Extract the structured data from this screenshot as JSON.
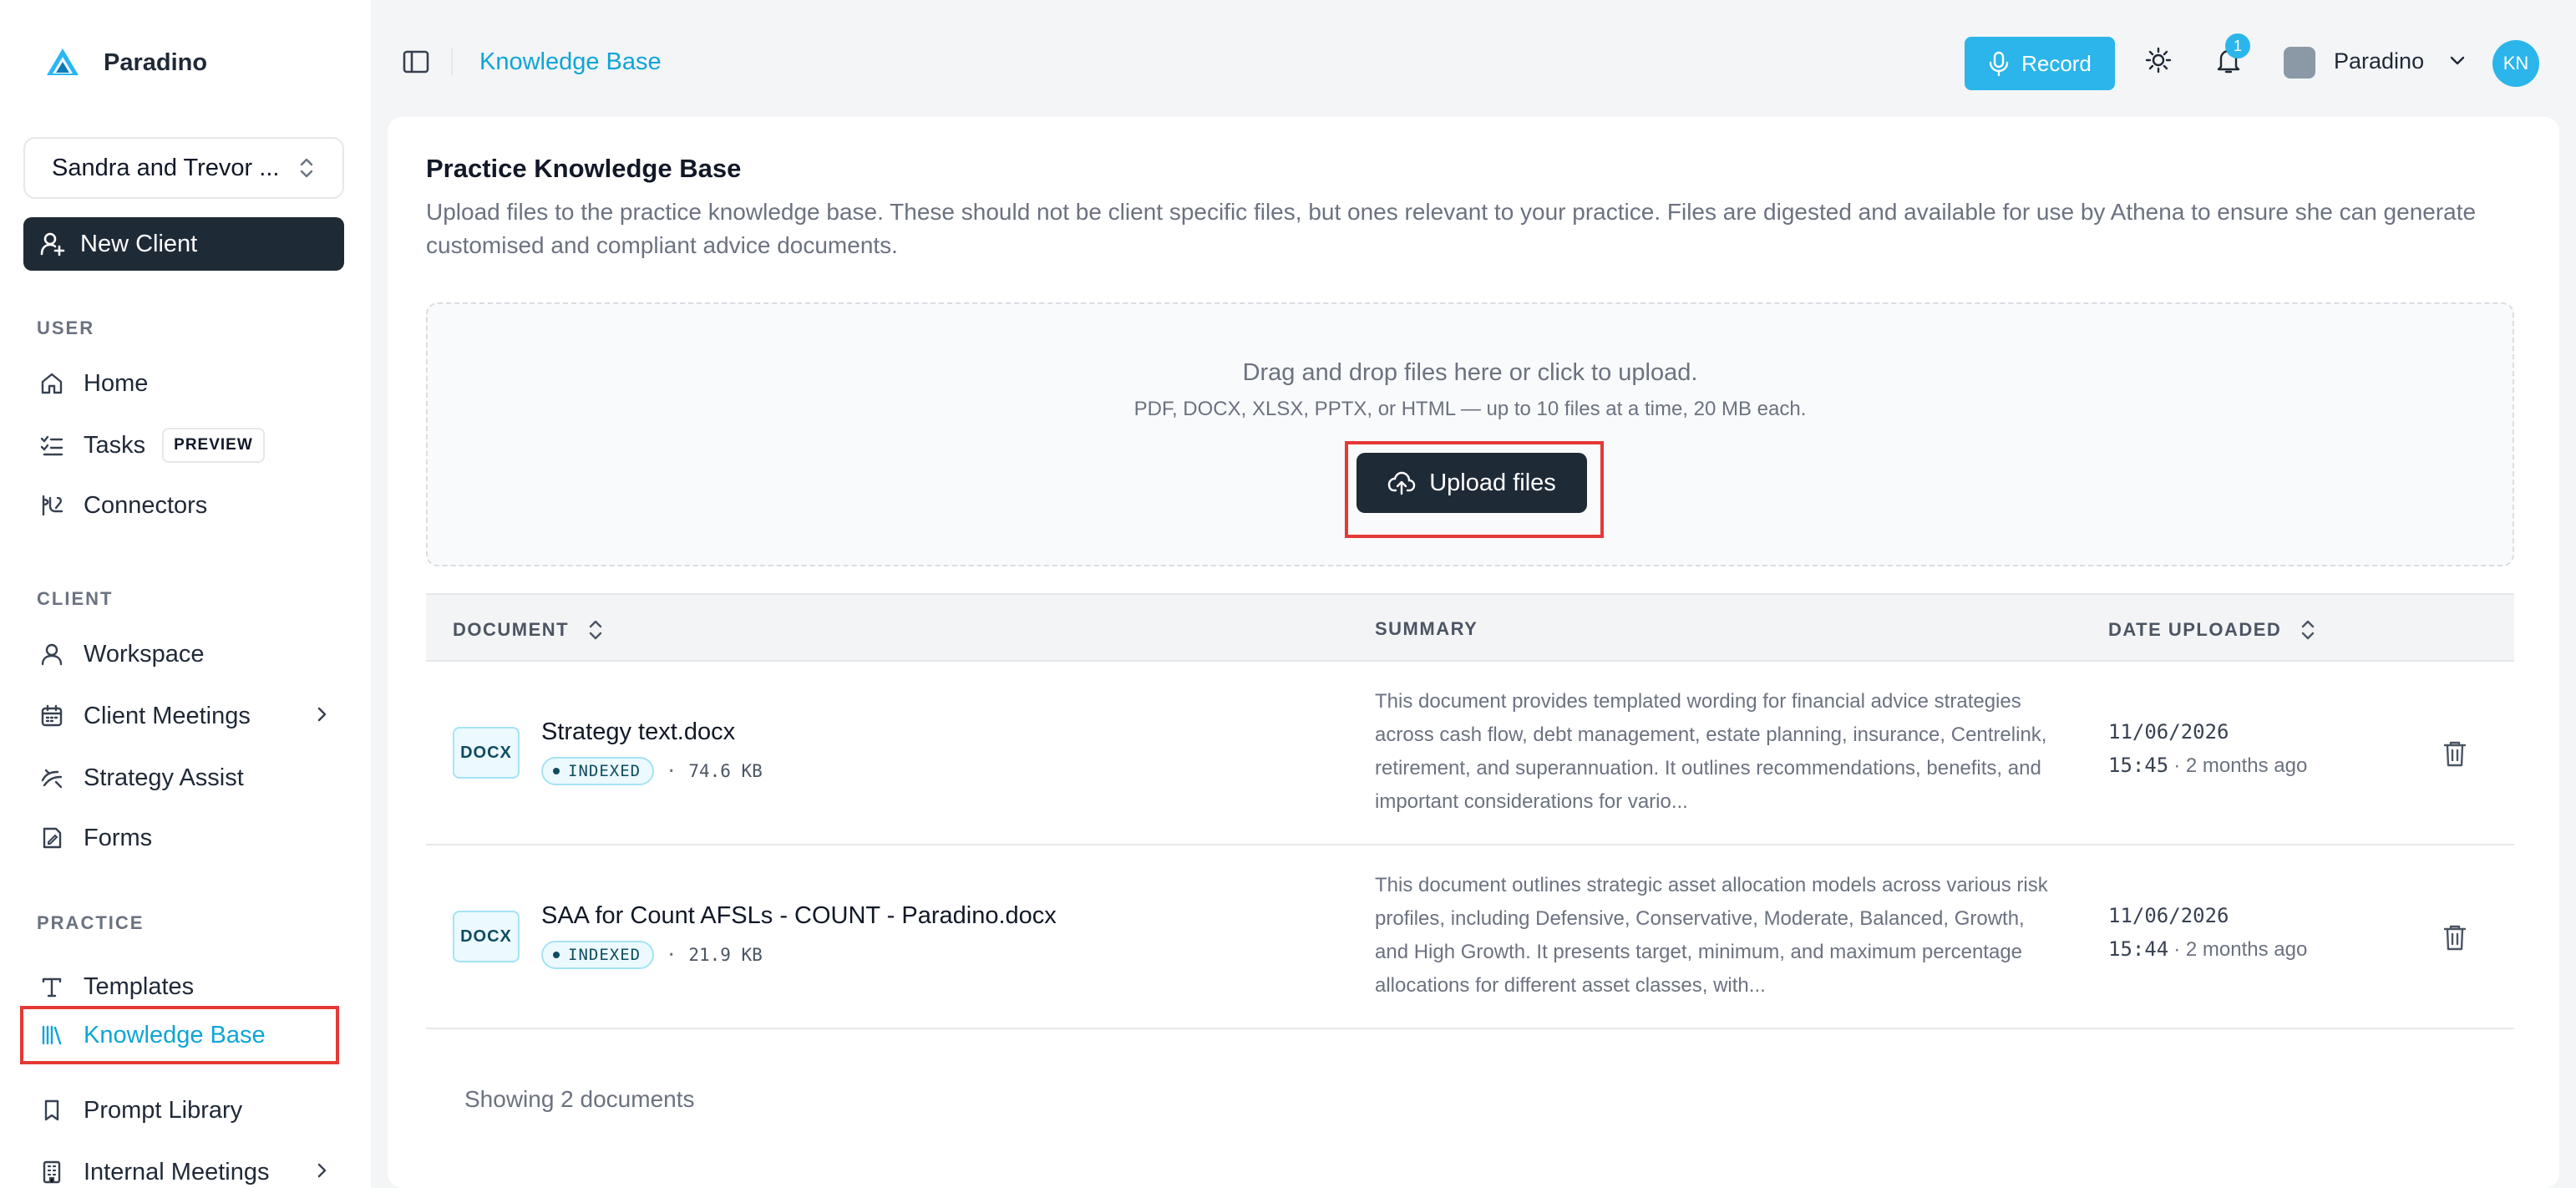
{
  "brand": {
    "name": "Paradino"
  },
  "sidebar": {
    "client_select": "Sandra and Trevor ...",
    "new_client": "New Client",
    "sections": {
      "user": "USER",
      "client": "CLIENT",
      "practice": "PRACTICE"
    },
    "user_items": [
      {
        "label": "Home",
        "icon": "home-icon"
      },
      {
        "label": "Tasks",
        "icon": "tasks-icon",
        "badge": "PREVIEW"
      },
      {
        "label": "Connectors",
        "icon": "connectors-icon"
      }
    ],
    "client_items": [
      {
        "label": "Workspace",
        "icon": "user-icon"
      },
      {
        "label": "Client Meetings",
        "icon": "calendar-icon"
      },
      {
        "label": "Strategy Assist",
        "icon": "strategy-icon"
      },
      {
        "label": "Forms",
        "icon": "form-icon"
      }
    ],
    "practice_items": [
      {
        "label": "Templates",
        "icon": "text-icon"
      },
      {
        "label": "Knowledge Base",
        "icon": "library-icon"
      },
      {
        "label": "Prompt Library",
        "icon": "bookmark-icon"
      },
      {
        "label": "Internal Meetings",
        "icon": "building-icon"
      }
    ]
  },
  "header": {
    "breadcrumb": "Knowledge Base",
    "record_label": "Record",
    "notification_count": "1",
    "org_name": "Paradino",
    "avatar_initials": "KN"
  },
  "main": {
    "title": "Practice Knowledge Base",
    "description": "Upload files to the practice knowledge base. These should not be client specific files, but ones relevant to your practice. Files are digested and available for use by Athena to ensure she can generate customised and compliant advice documents.",
    "dropzone": {
      "title": "Drag and drop files here or click to upload.",
      "subtitle": "PDF, DOCX, XLSX, PPTX, or HTML — up to 10 files at a time, 20 MB each.",
      "button": "Upload files"
    },
    "table": {
      "columns": [
        "DOCUMENT",
        "SUMMARY",
        "DATE UPLOADED"
      ],
      "rows": [
        {
          "type": "DOCX",
          "name": "Strategy text.docx",
          "status": "INDEXED",
          "size": "74.6 KB",
          "summary": "This document provides templated wording for financial advice strategies across cash flow, debt management, estate planning, insurance, Centrelink, retirement, and superannuation. It outlines recommendations, benefits, and important considerations for vario...",
          "date": "11/06/2026",
          "time": "15:45",
          "ago": "· 2 months ago"
        },
        {
          "type": "DOCX",
          "name": "SAA for Count AFSLs - COUNT - Paradino.docx",
          "status": "INDEXED",
          "size": "21.9 KB",
          "summary": "This document outlines strategic asset allocation models across various risk profiles, including Defensive, Conservative, Moderate, Balanced, Growth, and High Growth. It presents target, minimum, and maximum percentage allocations for different asset classes, with...",
          "date": "11/06/2026",
          "time": "15:44",
          "ago": "· 2 months ago"
        }
      ],
      "footer": "Showing 2 documents"
    }
  },
  "colors": {
    "accent": "#2bb5ea",
    "accent_text": "#0ea5d7",
    "dark_button": "#1f2a37",
    "highlight_box": "#e53935"
  }
}
